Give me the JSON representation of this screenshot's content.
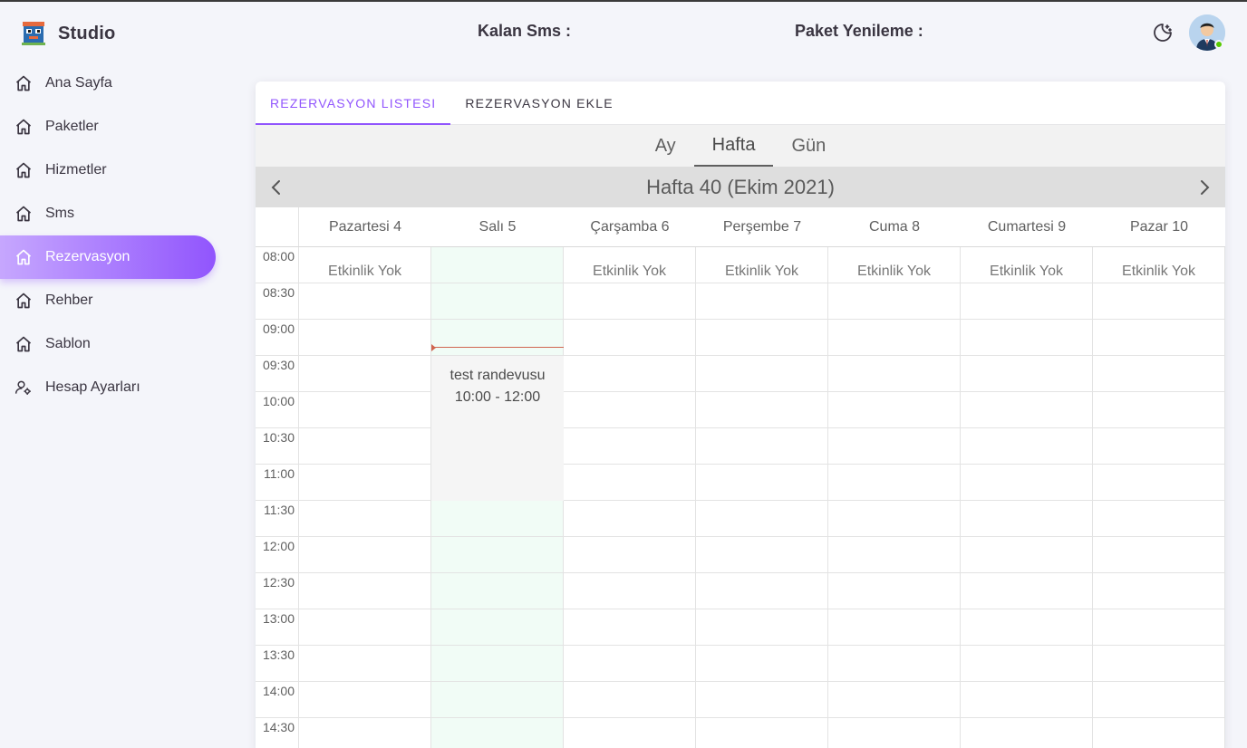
{
  "brand": {
    "name": "Studio",
    "logo_icon": "studio-logo-icon"
  },
  "sidebar": {
    "items": [
      {
        "label": "Ana Sayfa",
        "icon": "home-icon",
        "active": false
      },
      {
        "label": "Paketler",
        "icon": "home-icon",
        "active": false
      },
      {
        "label": "Hizmetler",
        "icon": "home-icon",
        "active": false
      },
      {
        "label": "Sms",
        "icon": "home-icon",
        "active": false
      },
      {
        "label": "Rezervasyon",
        "icon": "home-icon",
        "active": true
      },
      {
        "label": "Rehber",
        "icon": "home-icon",
        "active": false
      },
      {
        "label": "Sablon",
        "icon": "home-icon",
        "active": false
      },
      {
        "label": "Hesap Ayarları",
        "icon": "user-settings-icon",
        "active": false
      }
    ]
  },
  "header": {
    "sms_label": "Kalan Sms :",
    "renew_label": "Paket Yenileme :",
    "theme_icon": "moon-icon",
    "avatar_icon": "user-avatar-icon"
  },
  "tabs": [
    {
      "label": "REZERVASYON LISTESI",
      "active": true
    },
    {
      "label": "REZERVASYON EKLE",
      "active": false
    }
  ],
  "calendar": {
    "views": [
      {
        "label": "Ay",
        "active": false
      },
      {
        "label": "Hafta",
        "active": true
      },
      {
        "label": "Gün",
        "active": false
      }
    ],
    "week_title": "Hafta 40 (Ekim 2021)",
    "days": [
      "Pazartesi 4",
      "Salı 5",
      "Çarşamba 6",
      "Perşembe 7",
      "Cuma 8",
      "Cumartesi 9",
      "Pazar 10"
    ],
    "times": [
      "08:00",
      "08:30",
      "09:00",
      "09:30",
      "10:00",
      "10:30",
      "11:00",
      "11:30",
      "12:00",
      "12:30",
      "13:00",
      "13:30",
      "14:00",
      "14:30"
    ],
    "empty_label": "Etkinlik Yok",
    "event": {
      "title": "test randevusu",
      "time": "10:00 - 12:00",
      "day": "Salı 5"
    },
    "colors": {
      "accent": "#9155fd",
      "today_bg": "#f1fcf6",
      "now_line": "#d0654f"
    }
  }
}
